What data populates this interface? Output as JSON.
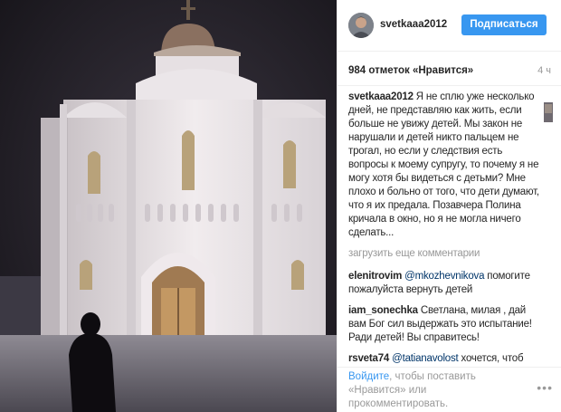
{
  "header": {
    "username": "svetkaaa2012",
    "follow_label": "Подписаться"
  },
  "stats": {
    "likes": "984 отметок «Нравится»",
    "time": "4 ч"
  },
  "caption": {
    "username": "svetkaaa2012",
    "text": "Я не сплю уже несколько дней, не представляю как жить, если больше не увижу детей. Мы закон не нарушали и детей никто пальцем не трогал, но если у следствия есть вопросы к моему супругу, то почему я не могу хотя бы видеться с детьми? Мне плохо и больно от того, что дети думают, что я их предала. Позавчера Полина кричала в окно, но я не могла ничего сделать..."
  },
  "load_more": "загрузить еще комментарии",
  "comments": [
    {
      "username": "elenitrovim",
      "mention": "@mkozhevnikova",
      "text": "помогите пожалуйста вернуть детей"
    },
    {
      "username": "iam_sonechka",
      "mention": "",
      "text": "Светлана, милая , дай вам Бог сил выдержать это испытание! Ради детей! Вы справитесь!"
    },
    {
      "username": "rsveta74",
      "mention": "@tatianavolost",
      "text": "хочется, чтоб правильно история закончилась... Мы"
    }
  ],
  "footer": {
    "login_link": "Войдите",
    "login_rest": ", чтобы поставить «Нравится» или прокомментировать.",
    "more": "•••"
  },
  "colors": {
    "accent": "#3897f0",
    "text": "#262626",
    "muted": "#999999",
    "border": "#efefef",
    "mention": "#003569"
  },
  "icons": {
    "options": "more-options-icon"
  }
}
